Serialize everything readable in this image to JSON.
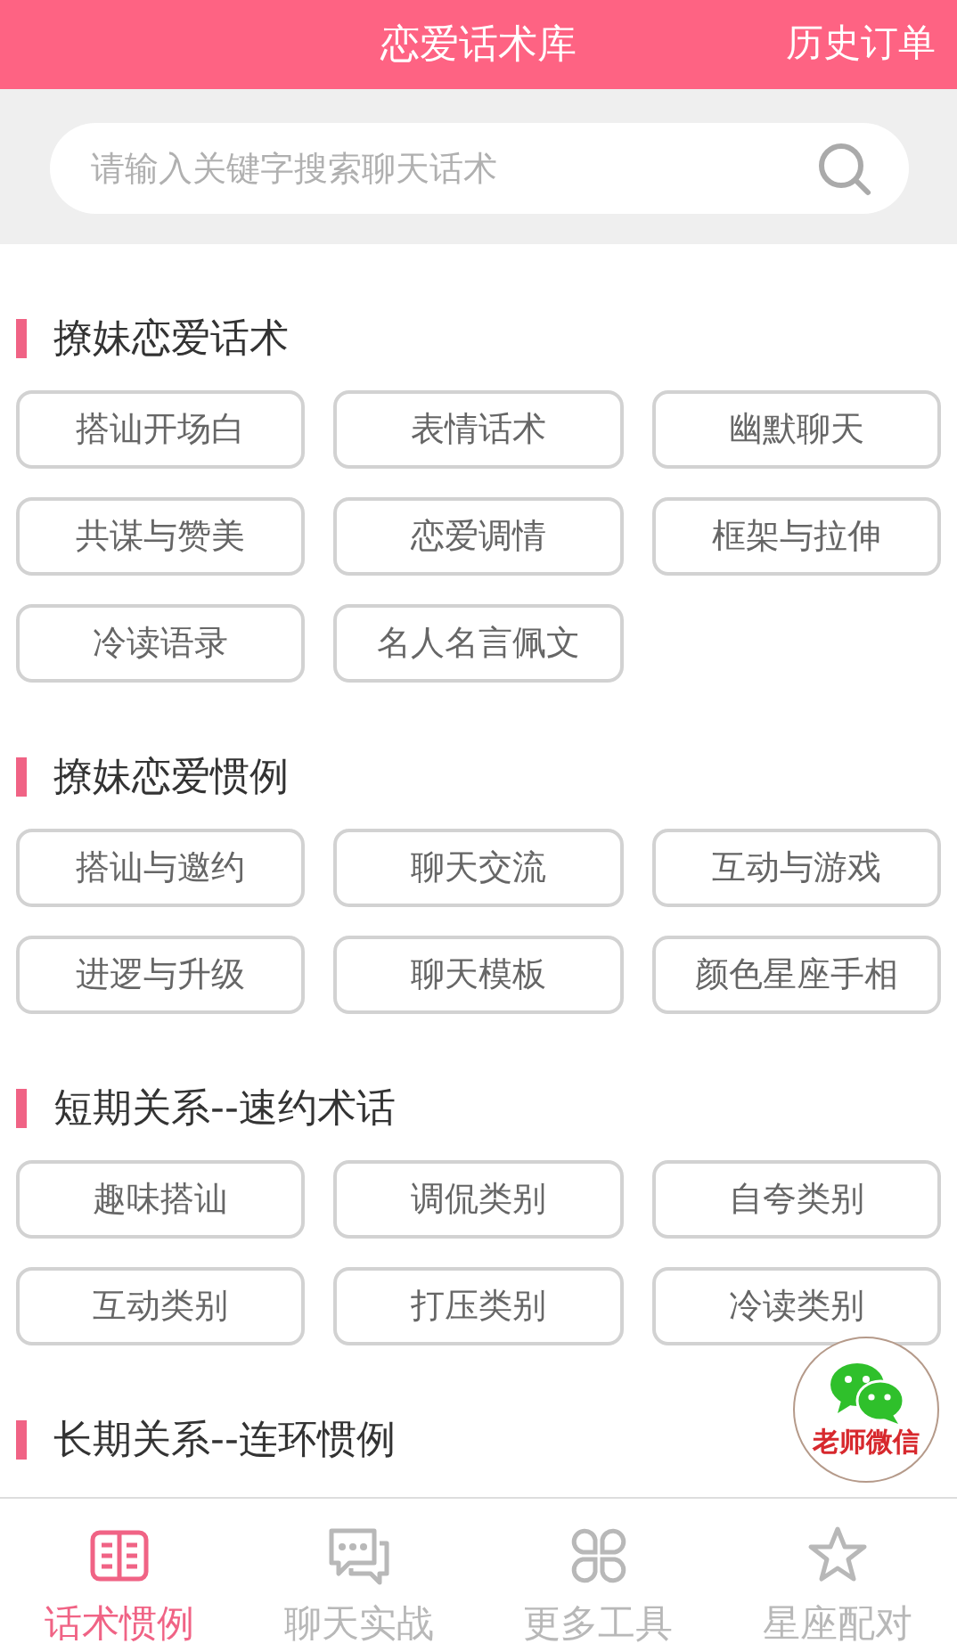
{
  "header": {
    "title": "恋爱话术库",
    "action": "历史订单"
  },
  "search": {
    "placeholder": "请输入关键字搜索聊天话术"
  },
  "sections": [
    {
      "title": "撩妹恋爱话术",
      "items": [
        "搭讪开场白",
        "表情话术",
        "幽默聊天",
        "共谋与赞美",
        "恋爱调情",
        "框架与拉伸",
        "冷读语录",
        "名人名言佩文"
      ]
    },
    {
      "title": "撩妹恋爱惯例",
      "items": [
        "搭讪与邀约",
        "聊天交流",
        "互动与游戏",
        "进逻与升级",
        "聊天模板",
        "颜色星座手相"
      ]
    },
    {
      "title": "短期关系--速约术话",
      "items": [
        "趣味搭讪",
        "调侃类别",
        "自夸类别",
        "互动类别",
        "打压类别",
        "冷读类别"
      ]
    },
    {
      "title": "长期关系--连环惯例"
    }
  ],
  "float_button": {
    "label": "老师微信"
  },
  "tabs": [
    {
      "label": "话术惯例",
      "kind": "book",
      "selected": true
    },
    {
      "label": "聊天实战",
      "kind": "chat",
      "selected": false
    },
    {
      "label": "更多工具",
      "kind": "grid",
      "selected": false
    },
    {
      "label": "星座配对",
      "kind": "star",
      "selected": false
    }
  ]
}
